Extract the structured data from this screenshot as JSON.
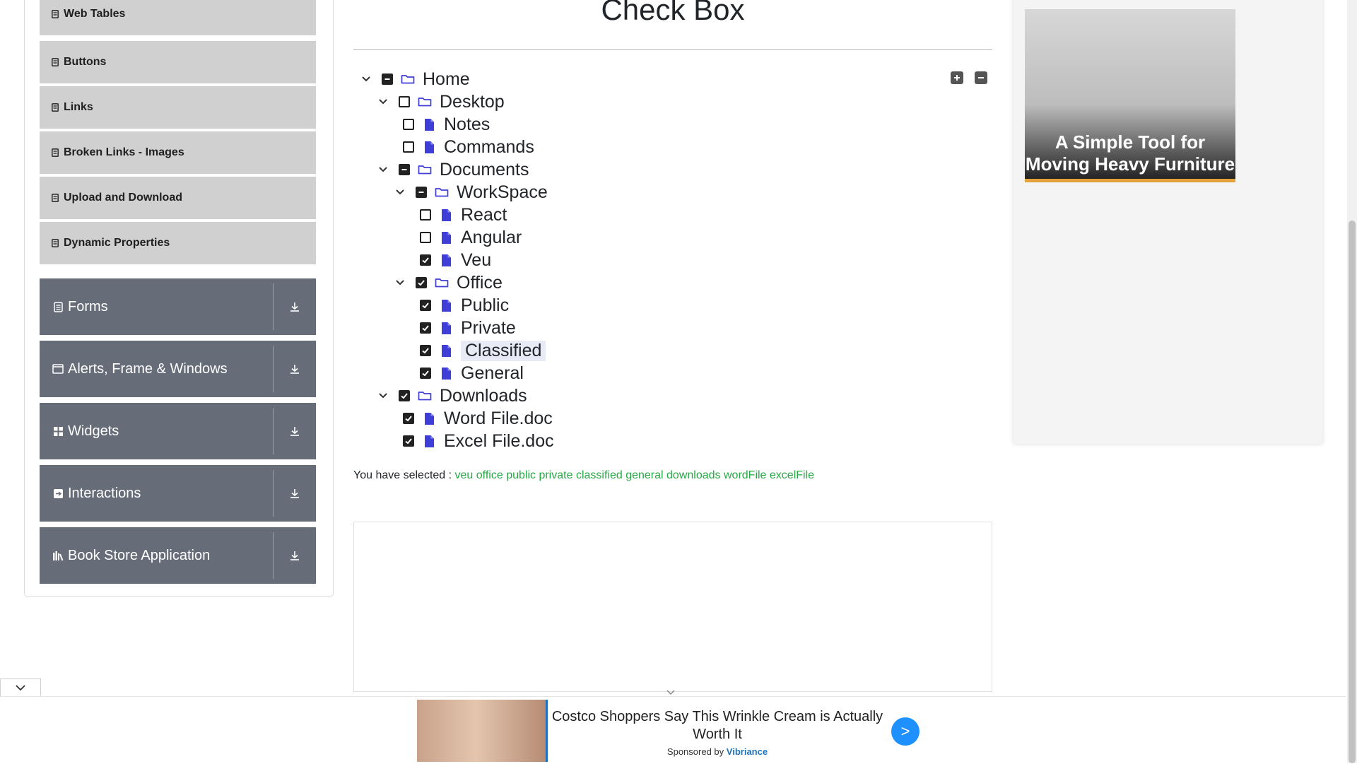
{
  "sidebar": {
    "subitems": [
      {
        "label": "Web Tables"
      },
      {
        "label": "Buttons"
      },
      {
        "label": "Links"
      },
      {
        "label": "Broken Links - Images"
      },
      {
        "label": "Upload and Download"
      },
      {
        "label": "Dynamic Properties"
      }
    ],
    "groups": [
      {
        "label": "Forms",
        "icon": "form-icon"
      },
      {
        "label": "Alerts, Frame & Windows",
        "icon": "window-icon"
      },
      {
        "label": "Widgets",
        "icon": "widgets-icon"
      },
      {
        "label": "Interactions",
        "icon": "interactions-icon"
      },
      {
        "label": "Book Store Application",
        "icon": "books-icon"
      }
    ]
  },
  "main": {
    "title": "Check Box",
    "tree": [
      {
        "label": "Home",
        "state": "half",
        "expanded": true,
        "folder": true
      },
      {
        "label": "Desktop",
        "state": "off",
        "expanded": true,
        "folder": true
      },
      {
        "label": "Notes",
        "state": "off",
        "folder": false
      },
      {
        "label": "Commands",
        "state": "off",
        "folder": false
      },
      {
        "label": "Documents",
        "state": "half",
        "expanded": true,
        "folder": true
      },
      {
        "label": "WorkSpace",
        "state": "half",
        "expanded": true,
        "folder": true
      },
      {
        "label": "React",
        "state": "off",
        "folder": false
      },
      {
        "label": "Angular",
        "state": "off",
        "folder": false
      },
      {
        "label": "Veu",
        "state": "on",
        "folder": false
      },
      {
        "label": "Office",
        "state": "on",
        "expanded": true,
        "folder": true
      },
      {
        "label": "Public",
        "state": "on",
        "folder": false
      },
      {
        "label": "Private",
        "state": "on",
        "folder": false
      },
      {
        "label": "Classified",
        "state": "on",
        "folder": false,
        "highlighted": true
      },
      {
        "label": "General",
        "state": "on",
        "folder": false
      },
      {
        "label": "Downloads",
        "state": "on",
        "expanded": true,
        "folder": true
      },
      {
        "label": "Word File.doc",
        "state": "on",
        "folder": false
      },
      {
        "label": "Excel File.doc",
        "state": "on",
        "folder": false
      }
    ],
    "result_prefix": "You have selected :",
    "selected": [
      "veu",
      "office",
      "public",
      "private",
      "classified",
      "general",
      "downloads",
      "wordFile",
      "excelFile"
    ]
  },
  "side_ad": {
    "caption": "A Simple Tool for Moving Heavy Furniture"
  },
  "bottom_ad": {
    "headline": "Costco Shoppers Say This Wrinkle Cream is Actually Worth It",
    "sponsored_prefix": "Sponsored by",
    "sponsor": "Vibriance",
    "cta": ">"
  },
  "colors": {
    "sidebar_group": "#666d79",
    "sidebar_item": "#d0d0d0",
    "selected_text": "#28a745",
    "tree_icon": "#3f3fd8"
  }
}
